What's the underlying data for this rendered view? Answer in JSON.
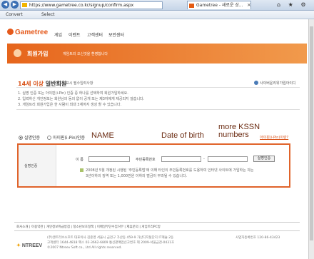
{
  "browser": {
    "url": "https://www.gametree.co.kr/signup/confirm.aspx",
    "tab_title": "Gametree - 새로운 상...",
    "tab_close": "×",
    "right_icons": "⌂ ★ ⚙",
    "back": "◀",
    "forward": "▶",
    "cmd_convert": "Convert",
    "cmd_select": "Select"
  },
  "site": {
    "logo": "Gametree",
    "nav": [
      "게임",
      "이벤트",
      "고객센터",
      "보안센터"
    ],
    "banner_title": "회원가입",
    "banner_sub": "게임트리 오신것을 환영합니다",
    "heading_accent": "14세 이상",
    "heading_rest": " 일반회원",
    "required_note": "* 표시 필수입력사항",
    "existing_link": "사이버윤리위가입아이디",
    "desc": [
      "1. 실명 인증 또는 아이핀(i-Pin) 인증 중 하나를 선택하여 회원가입하세요.",
      "2. 입력하신 개인정보는 회원님의 동의 없이 공개 또는 제3자에게 제공되지 않습니다.",
      "3. 게임트리 회원가입은 한 사람이 최대 3계까지 생성 할 수 있습니다."
    ],
    "radio_real": "실명인증",
    "radio_ipin": "아이핀(i-Pin)인증",
    "ipin_link": "아이핀(i-Pin)이란?",
    "row_label": "실명인증",
    "name_label": "이 름",
    "ssn_label": "주민등록번호",
    "ssn_dash": "-",
    "verify_button": "실명인증",
    "notes": [
      "2008년 5월 개정된 시행된 '주민등록법'에 의해 타인의 주민등록번호를 도용하여 인터넷 사이트에 가입하는 자는",
      "3년이하의 징역 또는 1,000만원 이하의 벌금이 부과될 수 있습니다."
    ],
    "annotations": {
      "name": "NAME",
      "dob": "Date of birth",
      "more": "more KSSN\nnumbers"
    },
    "footer_links": "회사소개 | 이용약관 | 개인정보취급방침 | 청소년보호정책 | 이메일무단수집거부 | 제휴문의 | 게임트리PC방",
    "footer_brand_mark": "✦",
    "footer_brand": "NTREEV",
    "footer_info": [
      "(주)엔트리브소프트  대표이사 김준영  서울시 금천구 가산동 459-9 가산디지털단지 IT캐슬 2동",
      "고객센터 1644-4818  팩스 02-3662-6809  통신판매업신고번호 제 2009-서울금천-0431호",
      "©2007 Ntreev Soft co., Ltd All rights reserved."
    ],
    "footer_reg": "사업자등록번호 120-86-43423"
  }
}
